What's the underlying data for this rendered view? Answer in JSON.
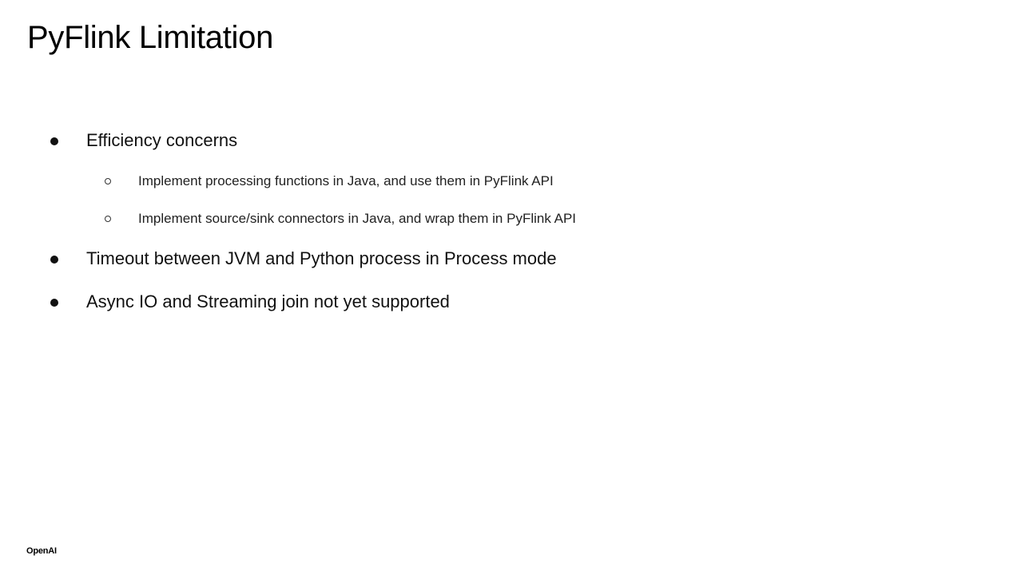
{
  "slide": {
    "title": "PyFlink Limitation",
    "bullets": [
      {
        "text": "Efficiency concerns",
        "sub_bullets": [
          "Implement processing functions in Java, and use them in PyFlink API",
          "Implement source/sink connectors in Java, and wrap them in PyFlink API"
        ]
      },
      {
        "text": "Timeout between JVM and Python process in Process mode"
      },
      {
        "text": "Async IO and Streaming join not yet supported"
      }
    ]
  },
  "footer": {
    "logo_text": "OpenAI"
  }
}
